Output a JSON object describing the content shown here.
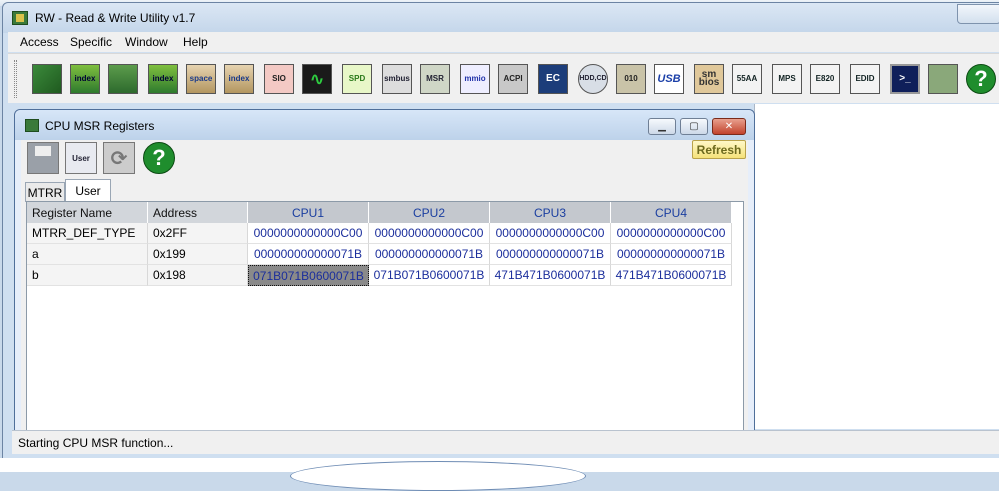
{
  "window": {
    "title": "RW - Read & Write Utility v1.7"
  },
  "menu": [
    "Access",
    "Specific",
    "Window",
    "Help"
  ],
  "toolbar": {
    "icons": [
      {
        "name": "pci-board-icon",
        "label": ""
      },
      {
        "name": "pci-index-icon",
        "label": "index"
      },
      {
        "name": "memory-icon",
        "label": ""
      },
      {
        "name": "memory-index-icon",
        "label": "index"
      },
      {
        "name": "io-space-icon",
        "label": "space"
      },
      {
        "name": "io-index-icon",
        "label": "index"
      },
      {
        "name": "sio-icon",
        "label": "SIO"
      },
      {
        "name": "wave-icon",
        "label": ""
      },
      {
        "name": "spd-icon",
        "label": "SPD"
      },
      {
        "name": "smbus-icon",
        "label": "smbus"
      },
      {
        "name": "msr-icon",
        "label": "MSR"
      },
      {
        "name": "mmio-icon",
        "label": "mmio"
      },
      {
        "name": "acpi-icon",
        "label": "ACPI"
      },
      {
        "name": "ec-icon",
        "label": "EC"
      },
      {
        "name": "hdd-cd-icon",
        "label": "HDD,CD"
      },
      {
        "name": "hex-010-icon",
        "label": "010"
      },
      {
        "name": "usb-icon",
        "label": "USB"
      },
      {
        "name": "smbios-icon",
        "label": "sm bios"
      },
      {
        "name": "55aa-icon",
        "label": "55AA"
      },
      {
        "name": "mps-icon",
        "label": "MPS"
      },
      {
        "name": "e820-icon",
        "label": "E820"
      },
      {
        "name": "edid-icon",
        "label": "EDID"
      },
      {
        "name": "command-icon",
        "label": ">_"
      },
      {
        "name": "card-icon",
        "label": ""
      },
      {
        "name": "help-icon",
        "label": "?"
      }
    ]
  },
  "child": {
    "title": "CPU MSR Registers",
    "tools": {
      "user_label": "User",
      "help_label": "?"
    },
    "refresh_label": "Refresh",
    "tabs": {
      "mtrr": "MTRR",
      "user": "User"
    }
  },
  "grid": {
    "headers": {
      "name": "Register Name",
      "address": "Address",
      "cpu1": "CPU1",
      "cpu2": "CPU2",
      "cpu3": "CPU3",
      "cpu4": "CPU4"
    },
    "rows": [
      {
        "name": "MTRR_DEF_TYPE",
        "address": "0x2FF",
        "cpu1": "0000000000000C00",
        "cpu2": "0000000000000C00",
        "cpu3": "0000000000000C00",
        "cpu4": "0000000000000C00"
      },
      {
        "name": "a",
        "address": "0x199",
        "cpu1": "000000000000071B",
        "cpu2": "000000000000071B",
        "cpu3": "000000000000071B",
        "cpu4": "000000000000071B"
      },
      {
        "name": "b",
        "address": "0x198",
        "cpu1": "071B071B0600071B",
        "cpu2": "071B071B0600071B",
        "cpu3": "471B471B0600071B",
        "cpu4": "471B471B0600071B"
      }
    ]
  },
  "status": {
    "text": "Starting CPU MSR function..."
  }
}
